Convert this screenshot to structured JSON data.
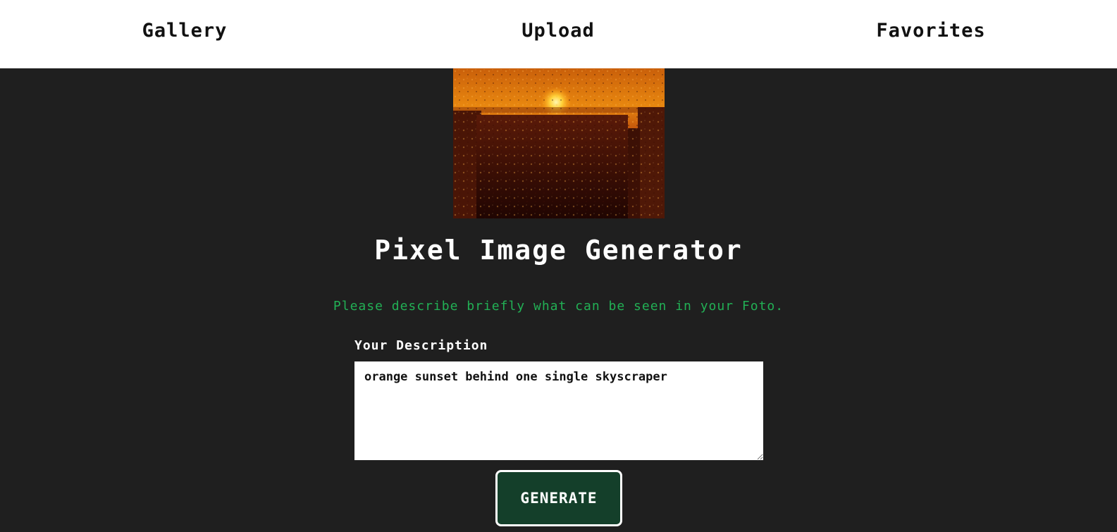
{
  "nav": {
    "gallery": "Gallery",
    "upload": "Upload",
    "favorites": "Favorites"
  },
  "main": {
    "title": "Pixel Image Generator",
    "hint": "Please describe briefly what can be seen in your Foto.",
    "description_label": "Your Description",
    "description_value": "orange sunset behind one single skyscraper",
    "generate_button": "GENERATE"
  },
  "colors": {
    "background": "#1f1f1f",
    "nav_background": "#ffffff",
    "hint_text": "#22b055",
    "button_background": "#143f2a",
    "sunset_orange": "#e07a10"
  },
  "preview_image": {
    "subject": "orange sunset behind skyscraper with raindrops"
  }
}
